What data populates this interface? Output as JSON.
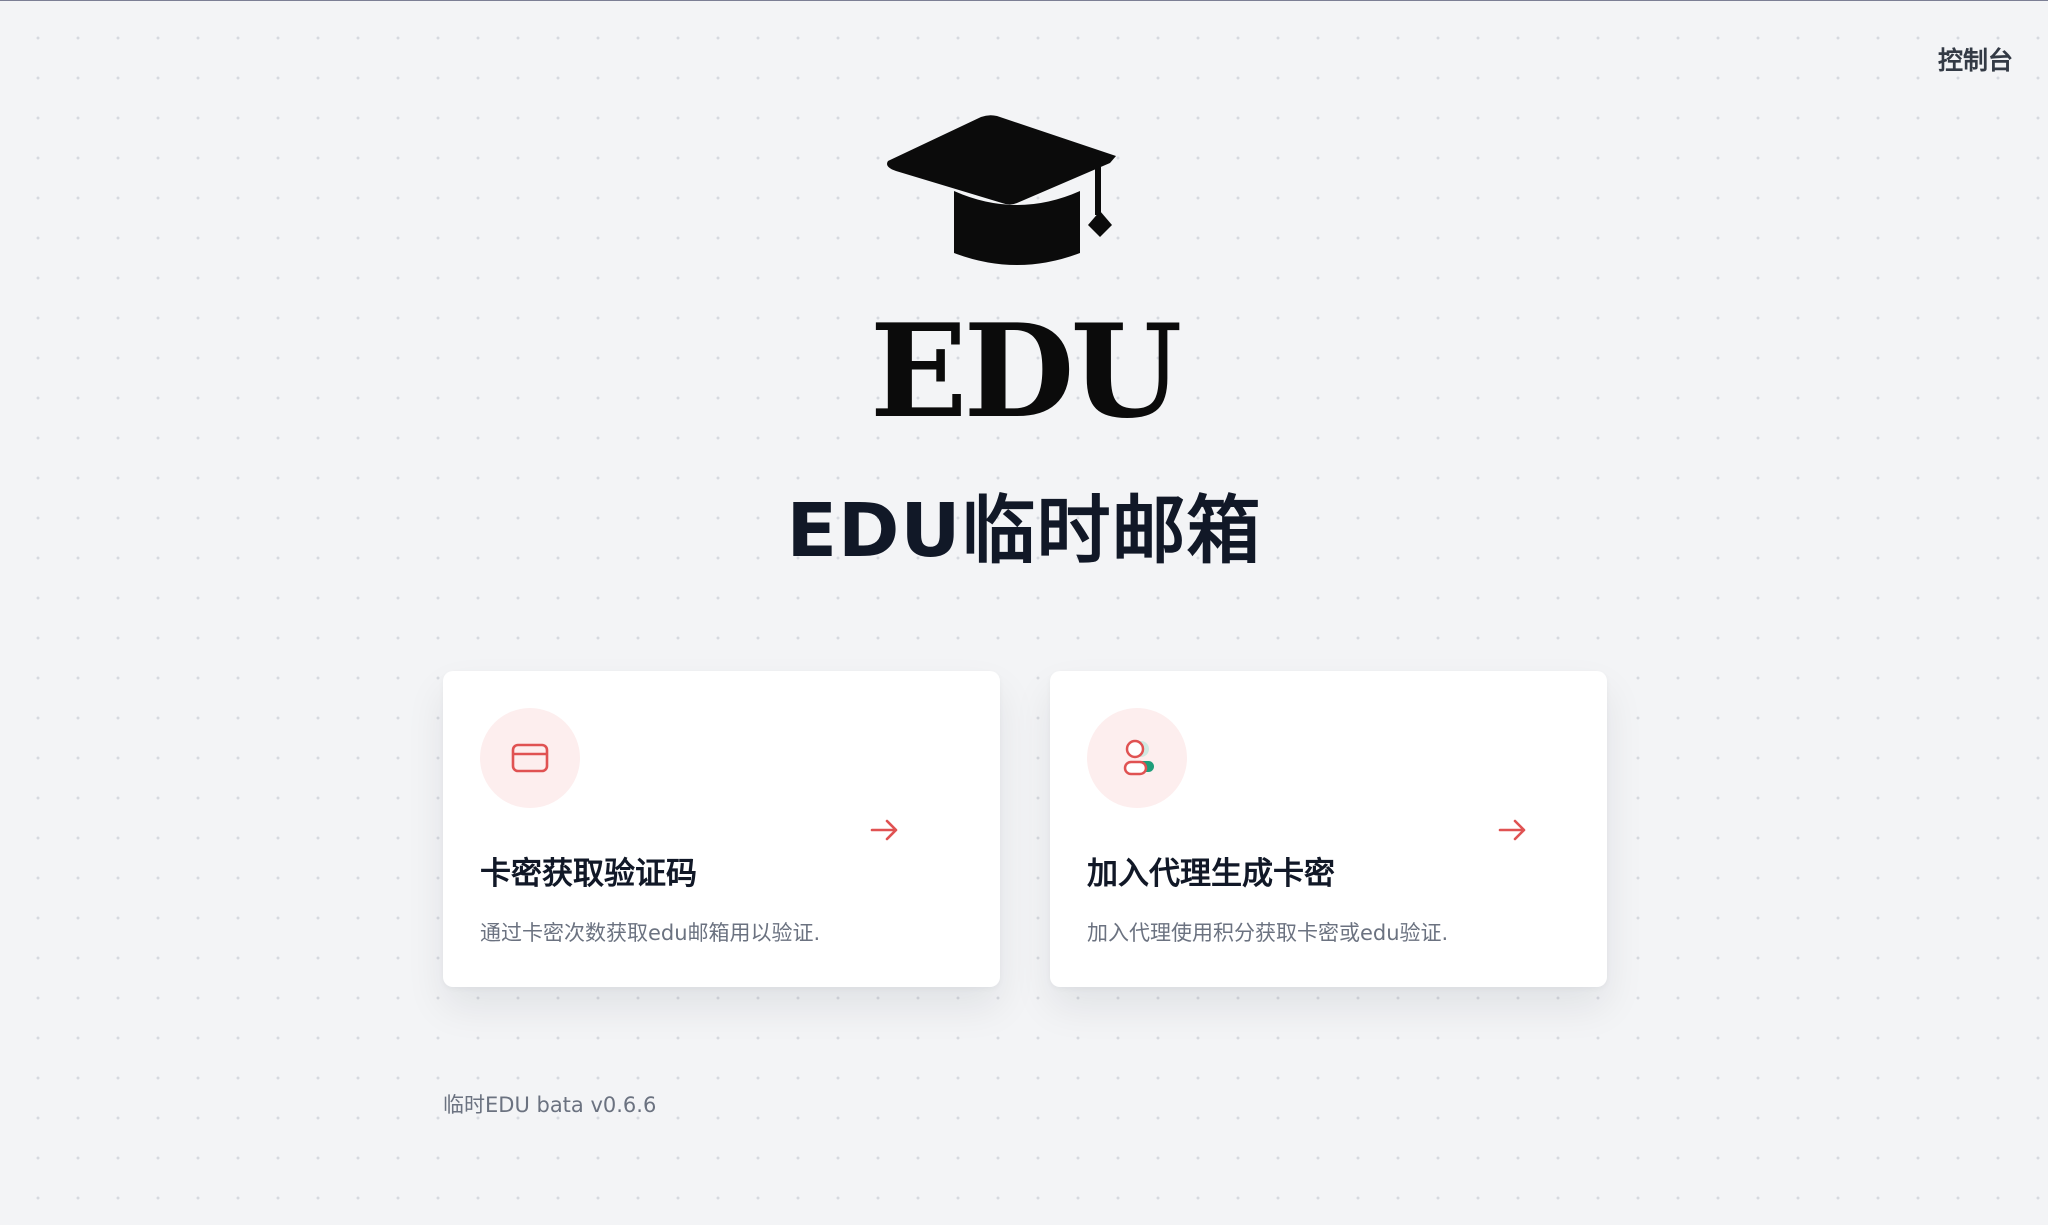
{
  "header": {
    "console_label": "控制台"
  },
  "logo": {
    "icon": "graduation-cap-icon",
    "wordmark": "EDU"
  },
  "page": {
    "title": "EDU临时邮箱"
  },
  "cards": [
    {
      "icon": "credit-card-icon",
      "arrow_icon": "arrow-right-icon",
      "title": "卡密获取验证码",
      "description": "通过卡密次数获取edu邮箱用以验证."
    },
    {
      "icon": "user-agent-icon",
      "arrow_icon": "arrow-right-icon",
      "title": "加入代理生成卡密",
      "description": "加入代理使用积分获取卡密或edu验证."
    }
  ],
  "footer": {
    "version": "临时EDU bata v0.6.6"
  },
  "colors": {
    "background": "#f3f4f6",
    "accent": "#e05252",
    "icon_circle": "#fdeeee",
    "title_text": "#111827",
    "muted_text": "#6b7280"
  }
}
